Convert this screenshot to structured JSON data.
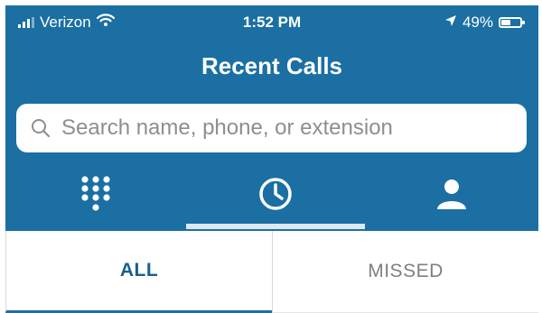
{
  "status_bar": {
    "carrier": "Verizon",
    "time": "1:52 PM",
    "battery": "49%",
    "battery_level": 0.49,
    "icons": [
      "signal-icon",
      "wifi-icon",
      "location-arrow-icon",
      "battery-icon"
    ]
  },
  "header": {
    "title": "Recent Calls"
  },
  "search": {
    "placeholder": "Search name, phone, or extension",
    "value": "",
    "icon": "search-icon"
  },
  "nav_tabs": [
    {
      "icon": "dialpad-icon",
      "active": false
    },
    {
      "icon": "clock-icon",
      "active": true
    },
    {
      "icon": "contact-icon",
      "active": false
    }
  ],
  "filter": {
    "options": [
      "ALL",
      "MISSED"
    ],
    "selected": "ALL"
  },
  "colors": {
    "brand_blue": "#1b6fa3",
    "selected_text": "#1b5f8c",
    "unselected_text": "#7f7f7f"
  }
}
